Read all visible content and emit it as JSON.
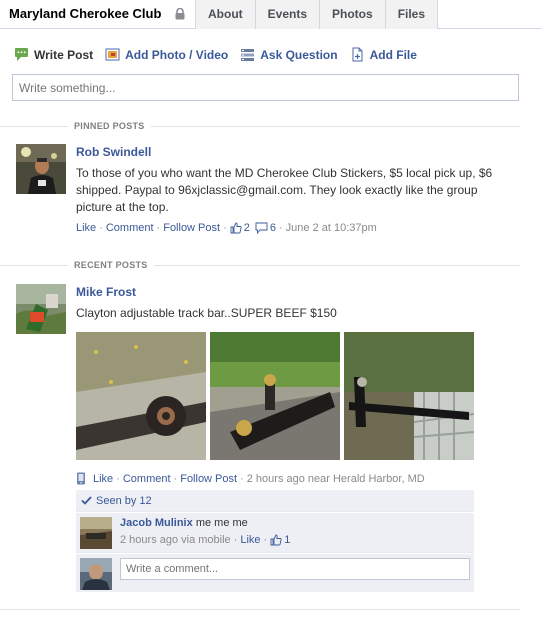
{
  "header": {
    "group_name": "Maryland Cherokee Club",
    "tabs": [
      "About",
      "Events",
      "Photos",
      "Files"
    ]
  },
  "composer": {
    "tabs": [
      "Write Post",
      "Add Photo / Video",
      "Ask Question",
      "Add File"
    ],
    "placeholder": "Write something..."
  },
  "sections": {
    "pinned": "PINNED POSTS",
    "recent": "RECENT POSTS"
  },
  "pinned_post": {
    "author": "Rob Swindell",
    "text": "To those of you who want the MD Cherokee Club Stickers, $5 local pick up, $6 shipped. Paypal to 96xjclassic@gmail.com. They look exactly like the group picture at the top.",
    "actions": {
      "like": "Like",
      "comment": "Comment",
      "follow": "Follow Post",
      "likes_count": "2",
      "comments_count": "6",
      "time": "June 2 at 10:37pm"
    }
  },
  "recent_post": {
    "author": "Mike Frost",
    "text": "Clayton adjustable track bar..SUPER BEEF $150",
    "actions": {
      "like": "Like",
      "comment": "Comment",
      "follow": "Follow Post",
      "time": "2 hours ago near Herald Harbor, MD"
    },
    "seen_by": "Seen by 12",
    "comment": {
      "author": "Jacob Mulinix",
      "text": "me me me",
      "time": "2 hours ago via mobile",
      "like": "Like",
      "likes_count": "1"
    },
    "comment_placeholder": "Write a comment..."
  },
  "colors": {
    "link": "#3b5998",
    "ufi_bg": "#edeff4",
    "border": "#bdc7d8"
  }
}
